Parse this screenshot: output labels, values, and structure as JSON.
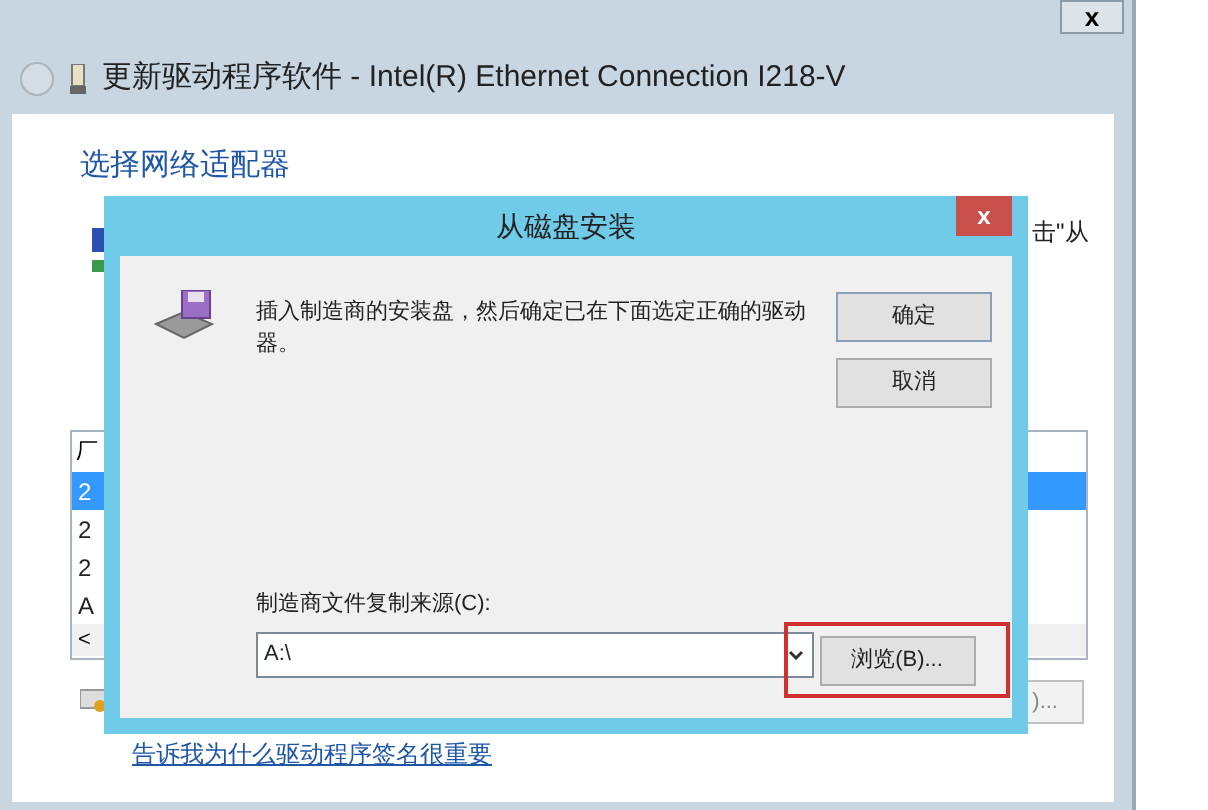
{
  "window": {
    "title": "更新驱动程序软件 - Intel(R) Ethernet Connection I218-V",
    "close": "x"
  },
  "page": {
    "heading": "选择网络适配器",
    "partial_text": "击\"从",
    "list": {
      "header": "厂",
      "rows": [
        {
          "text": "2",
          "selected": true
        },
        {
          "text": "2",
          "selected": false
        },
        {
          "text": "2",
          "selected": false
        },
        {
          "text": "A",
          "selected": false
        }
      ],
      "scroll": "<"
    },
    "partial_button": ")...",
    "link": "告诉我为什么驱动程序签名很重要"
  },
  "dialog": {
    "title": "从磁盘安装",
    "close": "x",
    "message": "插入制造商的安装盘，然后确定已在下面选定正确的驱动器。",
    "ok": "确定",
    "cancel": "取消",
    "source_label": "制造商文件复制来源(C):",
    "source_value": "A:\\",
    "browse": "浏览(B)...",
    "browse_highlighted": true
  }
}
